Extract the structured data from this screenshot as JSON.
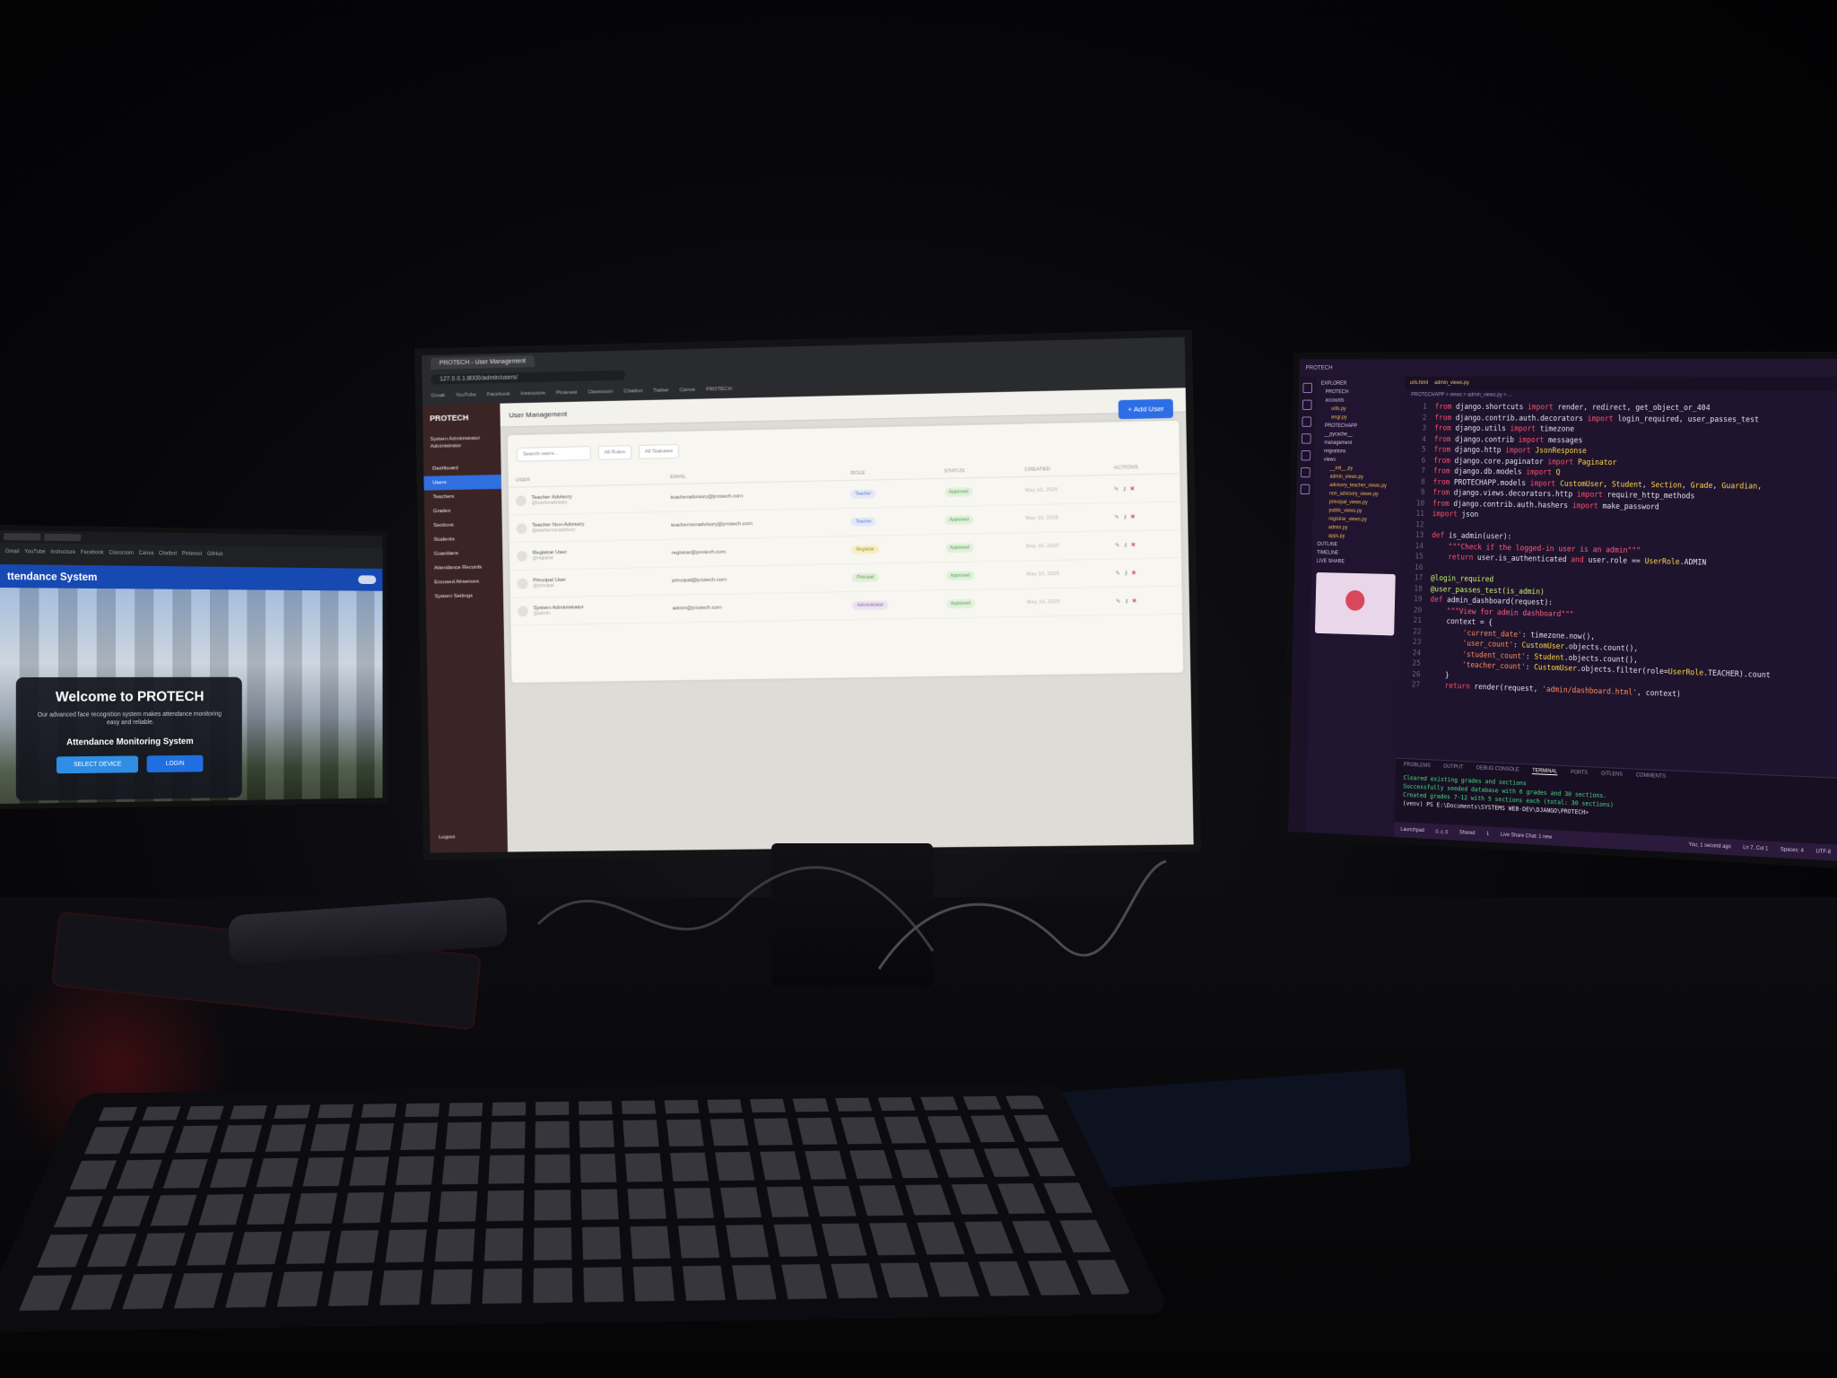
{
  "left_monitor": {
    "nav_title": "ttendance System",
    "welcome_title": "Welcome to PROTECH",
    "welcome_desc": "Our advanced face recognition system makes attendance monitoring easy and reliable.",
    "welcome_subtitle": "Attendance Monitoring System",
    "btn_primary": "SELECT DEVICE",
    "btn_login": "LOGIN",
    "bookmarks": [
      "Gmail",
      "YouTube",
      "Instructure",
      "Facebook",
      "Classroom",
      "Canva",
      "Chatbot",
      "Pinterest",
      "GitHub"
    ]
  },
  "center_monitor": {
    "browser": {
      "tab_title": "PROTECH - User Management",
      "url": "127.0.0.1:8000/admin/users/",
      "bookmarks": [
        "Gmail",
        "YouTube",
        "Facebook",
        "Instructure",
        "Pinterest",
        "Classroom",
        "Chatbot",
        "Twitter",
        "Canva",
        "PROTECH"
      ]
    },
    "sidebar": {
      "logo": "PROTECH",
      "user_name": "System Administrator",
      "user_role": "Administrator",
      "items": [
        "Dashboard",
        "Users",
        "Teachers",
        "Grades",
        "Sections",
        "Students",
        "Guardians",
        "Attendance Records",
        "Excused Absences",
        "System Settings"
      ],
      "logout": "Logout"
    },
    "page_title": "User Management",
    "add_button": "Add User",
    "filters": {
      "search_placeholder": "Search users...",
      "roles": "All Roles",
      "statuses": "All Statuses"
    },
    "table": {
      "headers": [
        "USER",
        "EMAIL",
        "ROLE",
        "STATUS",
        "CREATED",
        "ACTIONS"
      ],
      "rows": [
        {
          "name": "Teacher Advisory",
          "handle": "@teacheradvisory",
          "email": "teacheradvisory@protech.com",
          "role": "Teacher",
          "status": "Approved",
          "created": "May 10, 2025"
        },
        {
          "name": "Teacher Non-Advisory",
          "handle": "@teachernonadvisory",
          "email": "teachernonadvisory@protech.com",
          "role": "Teacher",
          "status": "Approved",
          "created": "May 10, 2025"
        },
        {
          "name": "Registrar User",
          "handle": "@registrar",
          "email": "registrar@protech.com",
          "role": "Registrar",
          "status": "Approved",
          "created": "May 10, 2025"
        },
        {
          "name": "Principal User",
          "handle": "@principal",
          "email": "principal@protech.com",
          "role": "Principal",
          "status": "Approved",
          "created": "May 10, 2025"
        },
        {
          "name": "System Administrator",
          "handle": "@admin",
          "email": "admin@protech.com",
          "role": "Administrator",
          "status": "Approved",
          "created": "May 10, 2025"
        }
      ]
    },
    "colors": {
      "sidebar": "#3b2424",
      "accent": "#2d6ee6"
    }
  },
  "right_monitor": {
    "title": "PROTECH",
    "tabs": [
      "urls.html",
      "admin_views.py"
    ],
    "breadcrumb": "PROTECHAPP > views > admin_views.py > ...",
    "explorer_title": "EXPLORER",
    "explorer": [
      {
        "name": "PROTECH",
        "type": "folder"
      },
      {
        "name": "accounts",
        "type": "folder"
      },
      {
        "name": "utils.py",
        "type": "py"
      },
      {
        "name": "wsgi.py",
        "type": "py"
      },
      {
        "name": "PROTECHAPP",
        "type": "folder"
      },
      {
        "name": "__pycache__",
        "type": "folder"
      },
      {
        "name": "management",
        "type": "folder"
      },
      {
        "name": "migrations",
        "type": "folder"
      },
      {
        "name": "views",
        "type": "folder"
      },
      {
        "name": "__init__.py",
        "type": "py"
      },
      {
        "name": "admin_views.py",
        "type": "py"
      },
      {
        "name": "advisory_teacher_views.py",
        "type": "py"
      },
      {
        "name": "non_advisory_views.py",
        "type": "py"
      },
      {
        "name": "principal_views.py",
        "type": "py"
      },
      {
        "name": "public_views.py",
        "type": "py"
      },
      {
        "name": "registrar_views.py",
        "type": "py"
      },
      {
        "name": "admin.py",
        "type": "py"
      },
      {
        "name": "apps.py",
        "type": "py"
      },
      {
        "name": "OUTLINE",
        "type": "section"
      },
      {
        "name": "TIMELINE",
        "type": "section"
      },
      {
        "name": "LIVE SHARE",
        "type": "section"
      }
    ],
    "code_lines": [
      "from django.shortcuts import render, redirect, get_object_or_404",
      "from django.contrib.auth.decorators import login_required, user_passes_test",
      "from django.utils import timezone",
      "from django.contrib import messages",
      "from django.http import JsonResponse",
      "from django.core.paginator import Paginator",
      "from django.db.models import Q",
      "from PROTECHAPP.models import CustomUser, Student, Section, Grade, Guardian,",
      "from django.views.decorators.http import require_http_methods",
      "from django.contrib.auth.hashers import make_password",
      "import json",
      "",
      "def is_admin(user):",
      "    \"\"\"Check if the logged-in user is an admin\"\"\"",
      "    return user.is_authenticated and user.role == UserRole.ADMIN",
      "",
      "@login_required",
      "@user_passes_test(is_admin)",
      "def admin_dashboard(request):",
      "    \"\"\"View for admin dashboard\"\"\"",
      "    context = {",
      "        'current_date': timezone.now(),",
      "        'user_count': CustomUser.objects.count(),",
      "        'student_count': Student.objects.count(),",
      "        'teacher_count': CustomUser.objects.filter(role=UserRole.TEACHER).count",
      "    }",
      "    return render(request, 'admin/dashboard.html', context)"
    ],
    "panel_tabs": [
      "PROBLEMS",
      "OUTPUT",
      "DEBUG CONSOLE",
      "TERMINAL",
      "PORTS",
      "GITLENS",
      "COMMENTS"
    ],
    "active_panel_tab": "TERMINAL",
    "terminal_lines": [
      "Cleared existing grades and sections",
      "Successfully seeded database with 6 grades and 30 sections.",
      "Created grades 7-12 with 5 sections each (total: 30 sections)",
      "(venv) PS E:\\Documents\\SYSTEMS WEB-DEV\\DJANGO\\PROTECH> "
    ],
    "status_left": [
      "Launchpad",
      "0 ⚠ 0",
      "Shared",
      "1",
      "Live Share Chat: 1 new"
    ],
    "status_right": [
      "You, 1 second ago",
      "Ln 7, Col 1",
      "Spaces: 4",
      "UTF-8"
    ]
  }
}
